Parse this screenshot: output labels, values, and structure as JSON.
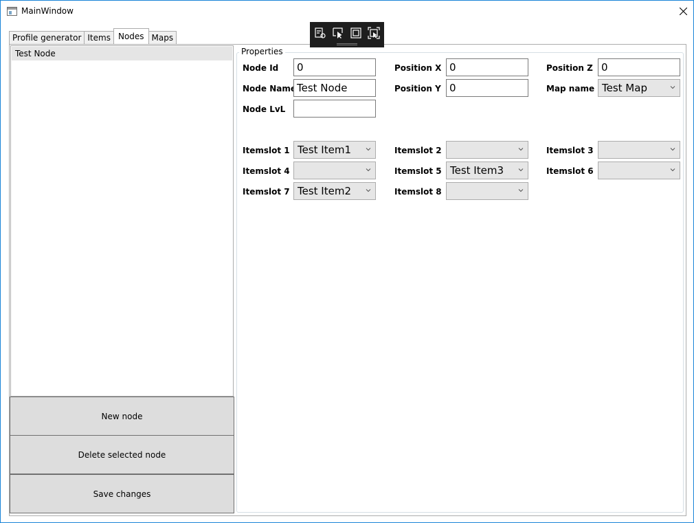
{
  "window": {
    "title": "MainWindow"
  },
  "tabs": [
    "Profile generator",
    "Items",
    "Nodes",
    "Maps"
  ],
  "node_list": {
    "items": [
      "Test Node"
    ]
  },
  "buttons": {
    "new_node": "New node",
    "delete_node": "Delete selected node",
    "save_changes": "Save changes"
  },
  "properties": {
    "title": "Properties",
    "node_id": {
      "label": "Node Id",
      "value": "0"
    },
    "node_name": {
      "label": "Node Name",
      "value": "Test Node"
    },
    "node_lvl": {
      "label": "Node LvL",
      "value": ""
    },
    "position_x": {
      "label": "Position X",
      "value": "0"
    },
    "position_y": {
      "label": "Position Y",
      "value": "0"
    },
    "position_z": {
      "label": "Position Z",
      "value": "0"
    },
    "map_name": {
      "label": "Map name",
      "value": "Test Map"
    },
    "itemslots": [
      {
        "label": "Itemslot 1",
        "value": "Test Item1"
      },
      {
        "label": "Itemslot 2",
        "value": ""
      },
      {
        "label": "Itemslot 3",
        "value": ""
      },
      {
        "label": "Itemslot 4",
        "value": ""
      },
      {
        "label": "Itemslot 5",
        "value": "Test Item3"
      },
      {
        "label": "Itemslot 6",
        "value": ""
      },
      {
        "label": "Itemslot 7",
        "value": "Test Item2"
      },
      {
        "label": "Itemslot 8",
        "value": ""
      }
    ]
  },
  "debug_toolbar": {
    "icons": [
      "live-visual-tree-icon",
      "select-element-icon",
      "display-layout-adorners-icon",
      "track-focused-element-icon"
    ]
  }
}
